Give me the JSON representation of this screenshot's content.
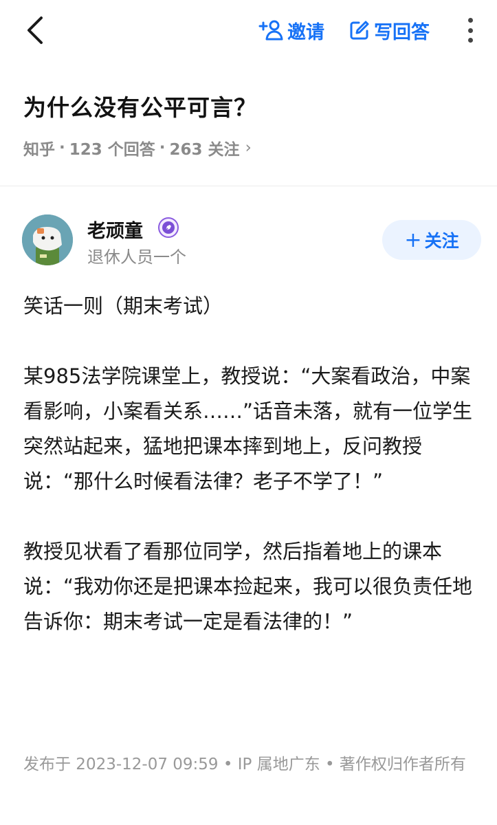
{
  "topbar": {
    "invite_label": "邀请",
    "write_label": "写回答"
  },
  "question": {
    "title": "为什么没有公平可言？",
    "source": "知乎",
    "answers": "123 个回答",
    "followers": "263 关注",
    "chevron": "›"
  },
  "author": {
    "name": "老顽童",
    "description": "退休人员一个",
    "follow_label": "关注",
    "follow_plus": "+"
  },
  "answer": {
    "paragraphs": [
      "笑话一则（期末考试）",
      "某985法学院课堂上，教授说：“大案看政治，中案看影响，小案看关系……”话音未落，就有一位学生突然站起来，猛地把课本摔到地上，反问教授说：“那什么时候看法律？老子不学了！”",
      "教授见状看了看那位同学，然后指着地上的课本说：“我劝你还是把课本捡起来，我可以很负责任地告诉你：期末考试一定是看法律的！”"
    ]
  },
  "footer": {
    "text": "发布于 2023-12-07 09:59 • IP 属地广东 • 著作权归作者所有"
  },
  "colors": {
    "accent": "#1772f6",
    "muted": "#8a8a8a",
    "badge": "#7b4fd6"
  }
}
